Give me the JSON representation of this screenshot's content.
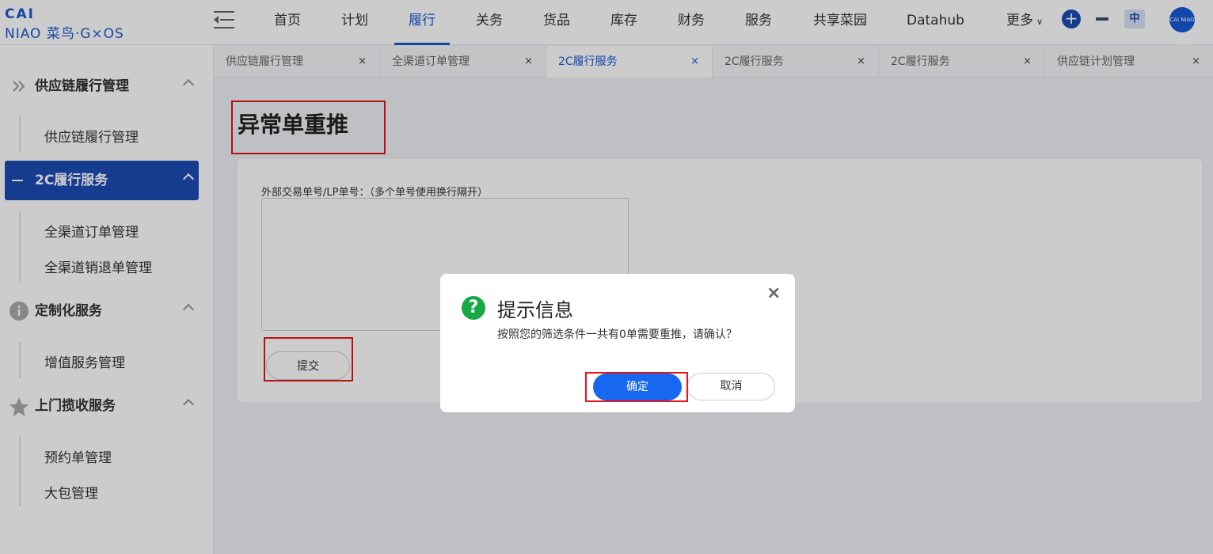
{
  "logo": {
    "line1": "CAI",
    "line2": "NIAO 菜鸟·G×OS"
  },
  "nav": {
    "items": [
      "首页",
      "计划",
      "履行",
      "关务",
      "货品",
      "库存",
      "财务",
      "服务",
      "共享菜园",
      "Datahub",
      "更多"
    ],
    "active": "履行",
    "lang": "中",
    "avatar_text": "CAI NIAO 菜鸟"
  },
  "sidebar": {
    "groups": [
      {
        "label": "供应链履行管理",
        "icon": "double-chevron-right-icon",
        "items": [
          "供应链履行管理"
        ]
      },
      {
        "label": "2C履行服务",
        "icon": "dash-icon",
        "active": true,
        "items": [
          "全渠道订单管理",
          "全渠道销退单管理"
        ]
      },
      {
        "label": "定制化服务",
        "icon": "info-circle-icon",
        "items": [
          "增值服务管理"
        ]
      },
      {
        "label": "上门揽收服务",
        "icon": "star-icon",
        "items": [
          "预约单管理",
          "大包管理"
        ]
      }
    ]
  },
  "tabs": [
    {
      "label": "供应链履行管理",
      "close": "×"
    },
    {
      "label": "全渠道订单管理",
      "close": "×"
    },
    {
      "label": "2C履行服务",
      "close": "×",
      "active": true
    },
    {
      "label": "2C履行服务",
      "close": "×"
    },
    {
      "label": "2C履行服务",
      "close": "×"
    },
    {
      "label": "供应链计划管理",
      "close": "×"
    }
  ],
  "page": {
    "title": "异常单重推",
    "field_label": "外部交易单号/LP单号：（多个单号使用换行隔开）",
    "textarea_value": "",
    "submit_label": "提交"
  },
  "modal": {
    "icon": "?",
    "title": "提示信息",
    "message": "按照您的筛选条件一共有0单需要重推，请确认？",
    "close": "×",
    "ok_label": "确定",
    "cancel_label": "取消"
  },
  "colors": {
    "accent": "#1858d6",
    "active_group": "#1c4bb5",
    "ok_button": "#1767f0",
    "highlight_box": "#e8141b",
    "success_icon": "#18a845"
  }
}
